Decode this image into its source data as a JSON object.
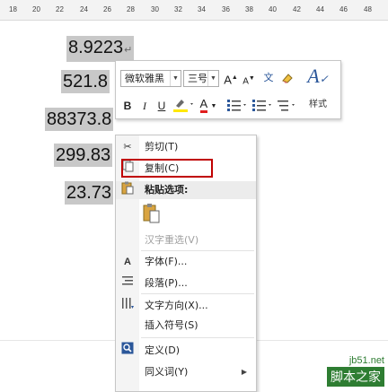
{
  "ruler": {
    "ticks": [
      "18",
      "20",
      "22",
      "24",
      "26",
      "28",
      "30",
      "32",
      "34",
      "36",
      "38",
      "40",
      "42",
      "44",
      "46",
      "48"
    ]
  },
  "document": {
    "numbers": [
      "8.9223",
      "521.8",
      "88373.8",
      "299.83",
      "23.73"
    ],
    "paragraph_mark": "↵"
  },
  "mini_toolbar": {
    "font_name": "微软雅黑",
    "font_size": "三号",
    "bold": "B",
    "italic": "I",
    "underline": "U",
    "grow_font": "A",
    "shrink_font": "A",
    "font_color_glyph": "A",
    "styles_label": "样式",
    "font_color_hex": "#e01e1e",
    "highlight_color_hex": "#ffe800"
  },
  "context_menu": {
    "items": [
      {
        "id": "cut",
        "label": "剪切(T)",
        "icon": "scissors-icon"
      },
      {
        "id": "copy",
        "label": "复制(C)",
        "icon": "copy-icon",
        "highlighted": true
      },
      {
        "id": "paste-options",
        "label": "粘贴选项:",
        "icon": "paste-icon"
      },
      {
        "id": "hanzi-reconvert",
        "label": "汉字重选(V)",
        "disabled": true
      },
      {
        "id": "font",
        "label": "字体(F)...",
        "icon": "font-icon"
      },
      {
        "id": "paragraph",
        "label": "段落(P)...",
        "icon": "paragraph-icon"
      },
      {
        "id": "text-direction",
        "label": "文字方向(X)...",
        "icon": "text-direction-icon"
      },
      {
        "id": "insert-symbol",
        "label": "插入符号(S)"
      },
      {
        "id": "define",
        "label": "定义(D)",
        "icon": "define-icon"
      },
      {
        "id": "synonyms",
        "label": "同义词(Y)",
        "submenu": true
      }
    ],
    "highlight_color": "#c00000"
  },
  "watermark": {
    "url": "jb51.net",
    "brand": "脚本之家"
  }
}
